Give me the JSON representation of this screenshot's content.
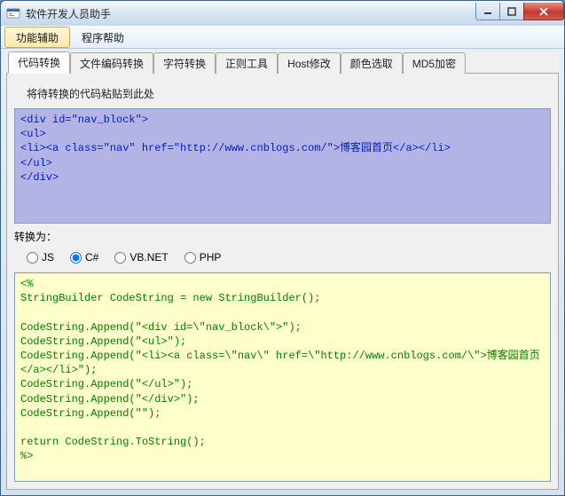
{
  "window": {
    "title": "软件开发人员助手"
  },
  "menubar": {
    "items": [
      {
        "label": "功能辅助",
        "active": true
      },
      {
        "label": "程序帮助",
        "active": false
      }
    ]
  },
  "tabs": [
    {
      "label": "代码转换",
      "active": true
    },
    {
      "label": "文件编码转换",
      "active": false
    },
    {
      "label": "字符转换",
      "active": false
    },
    {
      "label": "正则工具",
      "active": false
    },
    {
      "label": "Host修改",
      "active": false
    },
    {
      "label": "颜色选取",
      "active": false
    },
    {
      "label": "MD5加密",
      "active": false
    }
  ],
  "labels": {
    "paste_here": "将待转换的代码粘贴到此处",
    "convert_to": "转换为："
  },
  "input_code": {
    "lines": [
      "<div id=\"nav_block\">",
      "<ul>",
      "<li><a class=\"nav\" href=\"http://www.cnblogs.com/\">博客园首页</a></li>",
      "</ul>",
      "</div>"
    ]
  },
  "radios": {
    "options": [
      {
        "label": "JS",
        "value": "js",
        "checked": false
      },
      {
        "label": "C#",
        "value": "csharp",
        "checked": true
      },
      {
        "label": "VB.NET",
        "value": "vbnet",
        "checked": false
      },
      {
        "label": "PHP",
        "value": "php",
        "checked": false
      }
    ]
  },
  "output_code": {
    "lines": [
      "<%",
      "StringBuilder CodeString = new StringBuilder();",
      "",
      "CodeString.Append(\"<div id=\\\"nav_block\\\">\");",
      "CodeString.Append(\"<ul>\");",
      "CodeString.Append(\"<li><a class=\\\"nav\\\" href=\\\"http://www.cnblogs.com/\\\">博客园首页</a></li>\");",
      "CodeString.Append(\"</ul>\");",
      "CodeString.Append(\"</div>\");",
      "CodeString.Append(\"\");",
      "",
      "return CodeString.ToString();",
      "%>"
    ]
  }
}
